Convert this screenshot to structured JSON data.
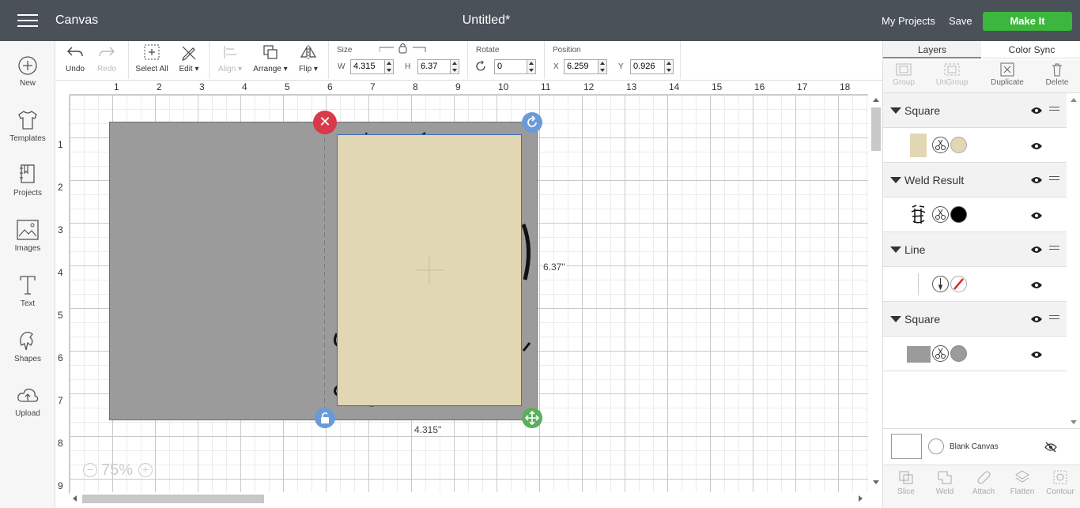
{
  "header": {
    "app_title": "Canvas",
    "document_title": "Untitled*",
    "my_projects": "My Projects",
    "save": "Save",
    "make_it": "Make It"
  },
  "sidebar": {
    "items": [
      {
        "label": "New",
        "icon": "plus-circle-icon"
      },
      {
        "label": "Templates",
        "icon": "shirt-icon"
      },
      {
        "label": "Projects",
        "icon": "book-icon"
      },
      {
        "label": "Images",
        "icon": "image-icon"
      },
      {
        "label": "Text",
        "icon": "text-icon"
      },
      {
        "label": "Shapes",
        "icon": "shapes-icon"
      },
      {
        "label": "Upload",
        "icon": "cloud-upload-icon"
      }
    ]
  },
  "toolbar": {
    "undo": "Undo",
    "redo": "Redo",
    "select_all": "Select All",
    "edit": "Edit",
    "align": "Align",
    "arrange": "Arrange",
    "flip": "Flip",
    "size_label": "Size",
    "w_label": "W",
    "w_value": "4.315",
    "h_label": "H",
    "h_value": "6.37",
    "rotate_label": "Rotate",
    "rotate_value": "0",
    "position_label": "Position",
    "x_label": "X",
    "x_value": "6.259",
    "y_label": "Y",
    "y_value": "0.926"
  },
  "canvas": {
    "ruler_top": [
      "1",
      "2",
      "3",
      "4",
      "5",
      "6",
      "7",
      "8",
      "9",
      "10",
      "11",
      "12",
      "13",
      "14",
      "15",
      "16",
      "17",
      "18"
    ],
    "ruler_left": [
      "1",
      "2",
      "3",
      "4",
      "5",
      "6",
      "7",
      "8",
      "9"
    ],
    "height_dimension": "6.37\"",
    "width_dimension": "4.315\"",
    "zoom": "75%",
    "colors": {
      "gray_square": "#9b9b9b",
      "beige_square": "#e2d7b4",
      "selection_outline": "#3d6db5",
      "delete_handle": "#d83a4a",
      "rotate_handle": "#6a9bd8",
      "scale_handle": "#5cae5c"
    }
  },
  "layers_panel": {
    "tabs": [
      "Layers",
      "Color Sync"
    ],
    "tools": [
      "Group",
      "UnGroup",
      "Duplicate",
      "Delete"
    ],
    "groups": [
      {
        "name": "Square",
        "swatch": "#e2d7b4",
        "op_icon": "scissors-icon"
      },
      {
        "name": "Weld Result",
        "swatch": "#000000",
        "op_icon": "scissors-icon"
      },
      {
        "name": "Line",
        "swatch": "#ffffff",
        "op_icon": "pen-icon"
      },
      {
        "name": "Square",
        "swatch": "#9b9b9b",
        "op_icon": "scissors-icon"
      }
    ],
    "blank_canvas": "Blank Canvas",
    "bottom_tools": [
      "Slice",
      "Weld",
      "Attach",
      "Flatten",
      "Contour"
    ]
  }
}
